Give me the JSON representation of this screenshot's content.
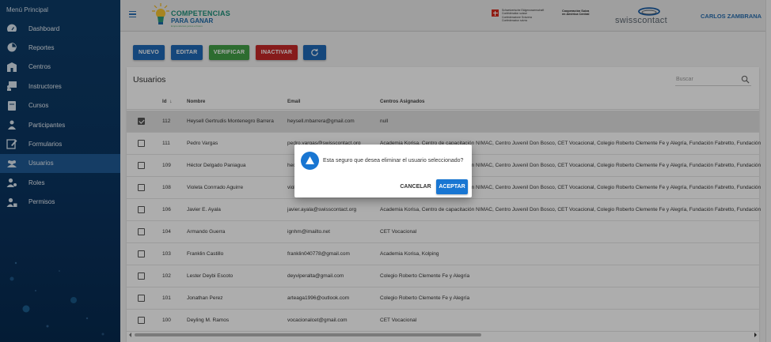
{
  "sidebar": {
    "title": "Menú Principal",
    "items": [
      {
        "label": "Dashboard",
        "icon": "dashboard-icon",
        "active": false
      },
      {
        "label": "Reportes",
        "icon": "pie-chart-icon",
        "active": false
      },
      {
        "label": "Centros",
        "icon": "building-icon",
        "active": false
      },
      {
        "label": "Instructores",
        "icon": "presenter-icon",
        "active": false
      },
      {
        "label": "Cursos",
        "icon": "book-icon",
        "active": false
      },
      {
        "label": "Participantes",
        "icon": "participant-icon",
        "active": false
      },
      {
        "label": "Formularios",
        "icon": "edit-form-icon",
        "active": false
      },
      {
        "label": "Usuarios",
        "icon": "users-icon",
        "active": true
      },
      {
        "label": "Roles",
        "icon": "user-gear-icon",
        "active": false
      },
      {
        "label": "Permisos",
        "icon": "user-lock-icon",
        "active": false
      }
    ]
  },
  "header": {
    "logo": {
      "line1": "COMPETENCIAS",
      "line2": "PARA GANAR",
      "line3": "Emprendamos juntos el futuro"
    },
    "swiss_lines": [
      "Schweizerische Eidgenossenschaft",
      "Confédération suisse",
      "Confederazione Svizzera",
      "Confederaziun svizra"
    ],
    "cooperation": [
      "Cooperación Suiza",
      "en América Central"
    ],
    "partner": "swisscontact",
    "user": "CARLOS ZAMBRANA"
  },
  "toolbar": {
    "nuevo": "NUEVO",
    "editar": "EDITAR",
    "verificar": "VERIFICAR",
    "inactivar": "INACTIVAR",
    "refresh_icon": "refresh-icon",
    "colors": {
      "nuevo": "#1f69b7",
      "editar": "#1f69b7",
      "verificar": "#43a047",
      "inactivar": "#c62828",
      "refresh": "#1f69b7"
    }
  },
  "table": {
    "title": "Usuarios",
    "search_placeholder": "Buscar",
    "columns": {
      "id": "Id",
      "sort": "↓",
      "nombre": "Nombre",
      "email": "Email",
      "centros": "Centros Asignados"
    },
    "rows": [
      {
        "id": "112",
        "nombre": "Heysell Gertrudis Montenegro Barrera",
        "email": "heysell.mbarrera@gmail.com",
        "centros": "null",
        "selected": true
      },
      {
        "id": "111",
        "nombre": "Pedro Vargas",
        "email": "pedro.vargas@swisscontact.org",
        "centros": "Academia Korisa, Centro de capacitación NIMAC, Centro Juvenil Don Bosco, CET Vocacional, Colegio Roberto Clemente Fe y Alegría, Fundación Fabretto, Fundación",
        "selected": false
      },
      {
        "id": "109",
        "nombre": "Héctor Delgado Paniagua",
        "email": "hector.delgado@swisscontact.org",
        "centros": "Academia Korisa, Centro de capacitación NIMAC, Centro Juvenil Don Bosco, CET Vocacional, Colegio Roberto Clemente Fe y Alegría, Fundación Fabretto, Fundación",
        "selected": false
      },
      {
        "id": "108",
        "nombre": "Violeta Conrrado Aguirre",
        "email": "violeta.conrrado@swisscontact.org",
        "centros": "Academia Korisa, Centro de capacitación NIMAC, Centro Juvenil Don Bosco, CET Vocacional, Colegio Roberto Clemente Fe y Alegría, Fundación Fabretto, Fundación",
        "selected": false
      },
      {
        "id": "106",
        "nombre": "Javier E. Ayala",
        "email": "javier.ayala@swisscontact.org",
        "centros": "Academia Korisa, Centro de capacitación NIMAC, Centro Juvenil Don Bosco, CET Vocacional, Colegio Roberto Clemente Fe y Alegría, Fundación Fabretto, Fundación",
        "selected": false
      },
      {
        "id": "104",
        "nombre": "Armando Guerra",
        "email": "ignhm@imailto.net",
        "centros": "CET Vocacional",
        "selected": false
      },
      {
        "id": "103",
        "nombre": "Franklin Castillo",
        "email": "franklin040778@gmail.com",
        "centros": "Academia Korisa, Kolping",
        "selected": false
      },
      {
        "id": "102",
        "nombre": "Lester Deybi Escoto",
        "email": "deyviperalta@gmail.com",
        "centros": "Colegio Roberto Clemente Fe y Alegría",
        "selected": false
      },
      {
        "id": "101",
        "nombre": "Jonathan Perez",
        "email": "arteaga1996@outlook.com",
        "centros": "Colegio Roberto Clemente Fe y Alegría",
        "selected": false
      },
      {
        "id": "100",
        "nombre": "Deyling M. Ramos",
        "email": "vocacionalcet@gmail.com",
        "centros": "CET Vocacional",
        "selected": false
      }
    ]
  },
  "dialog": {
    "message": "Esta seguro que desea eliminar el usuario seleccionado?",
    "cancel": "CANCELAR",
    "accept": "ACEPTAR",
    "icon": "warning-icon",
    "accent": "#1976d2"
  }
}
